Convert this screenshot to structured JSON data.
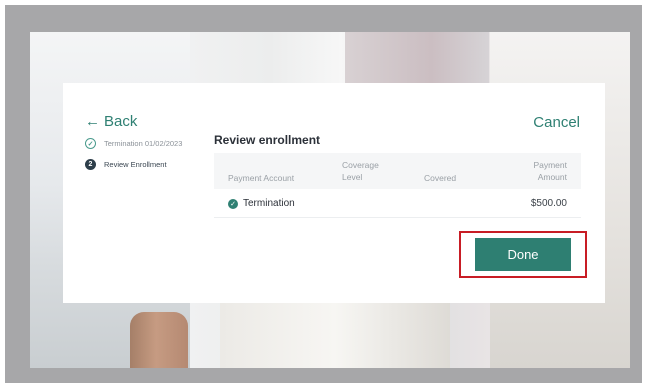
{
  "header": {
    "back_label": "Back",
    "cancel_label": "Cancel"
  },
  "steps": [
    {
      "label": "Termination 01/02/2023",
      "icon": "check-icon",
      "state": "completed"
    },
    {
      "label": "Review Enrollment",
      "number": "2",
      "state": "active"
    }
  ],
  "review": {
    "title": "Review enrollment",
    "columns": [
      "Payment Account",
      "Coverage Level",
      "Covered",
      "Payment Amount"
    ],
    "rows": [
      {
        "account": "Termination",
        "amount": "$500.00",
        "status_icon": "check-circle-icon"
      }
    ]
  },
  "actions": {
    "done_label": "Done"
  },
  "colors": {
    "accent": "#2e7f72",
    "highlight": "#c81d25",
    "frame": "#a7a7a9"
  }
}
